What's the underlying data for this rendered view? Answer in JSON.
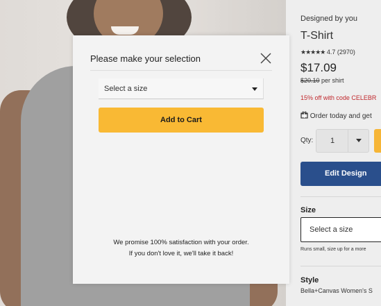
{
  "product": {
    "designed_by": "Designed by you",
    "title": "T-Shirt",
    "stars": "★★★★★",
    "rating": "4.7 (2970)",
    "price": "$17.09",
    "old_price": "$20.10",
    "per_unit": "per shirt",
    "promo": "15% off with code CELEBR",
    "order_text": "Order today and get",
    "qty_label": "Qty:",
    "qty_value": "1",
    "edit_design_label": "Edit Design",
    "size_label": "Size",
    "size_placeholder": "Select a size",
    "size_note": "Runs small, size up for a more",
    "style_label": "Style",
    "style_value": "Bella+Canvas Women's S"
  },
  "modal": {
    "title": "Please make your selection",
    "select_placeholder": "Select a size",
    "add_to_cart_label": "Add to Cart",
    "promise_line1": "We promise 100% satisfaction with your order.",
    "promise_line2": "If you don't love it, we'll take it back!"
  },
  "colors": {
    "accent": "#f9b934",
    "edit_button": "#2a4f8c",
    "promo": "#c0282d"
  }
}
